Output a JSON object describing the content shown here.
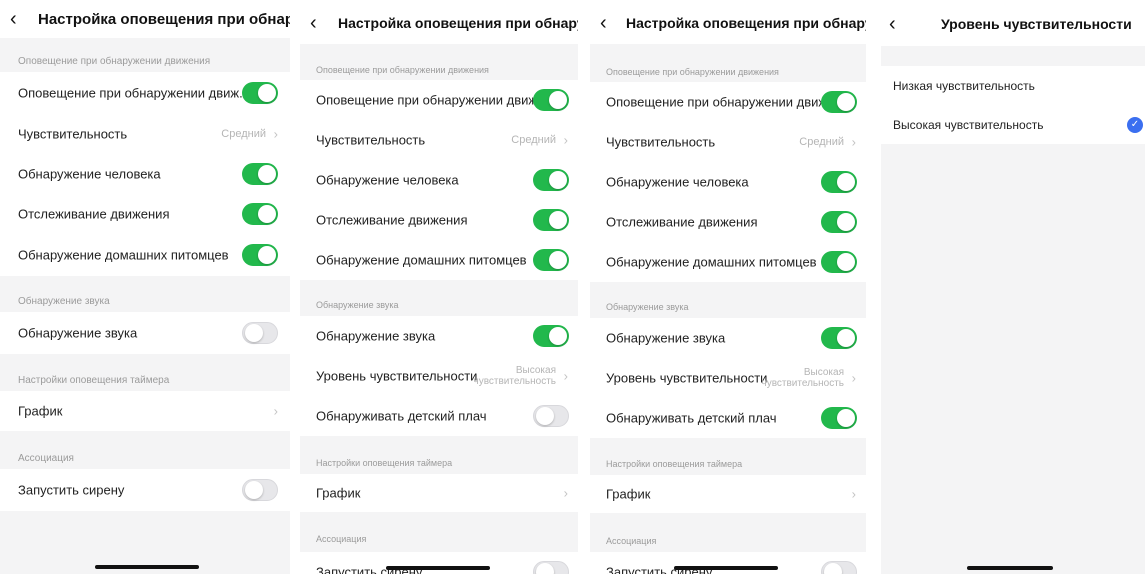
{
  "panel1": {
    "title": "Настройка оповещения при обнаруж...",
    "motion_section": "Оповещение при обнаружении движения",
    "motion_alert": "Оповещение при обнаружении движ...",
    "sensitivity": "Чувствительность",
    "sensitivity_value": "Средний",
    "human_detection": "Обнаружение человека",
    "motion_tracking": "Отслеживание движения",
    "pet_detection": "Обнаружение домашних питомцев",
    "sound_section": "Обнаружение звука",
    "sound_detection": "Обнаружение звука",
    "timer_section": "Настройки оповещения таймера",
    "schedule": "График",
    "assoc_section": "Ассоциация",
    "siren": "Запустить сирену"
  },
  "panel2": {
    "title": "Настройка оповещения при обнаруж...",
    "motion_section": "Оповещение при обнаружении движения",
    "motion_alert": "Оповещение при обнаружении движ...",
    "sensitivity": "Чувствительность",
    "sensitivity_value": "Средний",
    "human_detection": "Обнаружение человека",
    "motion_tracking": "Отслеживание движения",
    "pet_detection": "Обнаружение домашних питомцев",
    "sound_section": "Обнаружение звука",
    "sound_detection": "Обнаружение звука",
    "sound_level": "Уровень чувствительности",
    "sound_level_value_1": "Высокая",
    "sound_level_value_2": "чувствительность",
    "baby_cry": "Обнаруживать детский плач",
    "timer_section": "Настройки оповещения таймера",
    "schedule": "График",
    "assoc_section": "Ассоциация",
    "siren": "Запустить сирену"
  },
  "panel3": {
    "title": "Настройка оповещения при обнаруж...",
    "motion_section": "Оповещение при обнаружении движения",
    "motion_alert": "Оповещение при обнаружении движ...",
    "sensitivity": "Чувствительность",
    "sensitivity_value": "Средний",
    "human_detection": "Обнаружение человека",
    "motion_tracking": "Отслеживание движения",
    "pet_detection": "Обнаружение домашних питомцев",
    "sound_section": "Обнаружение звука",
    "sound_detection": "Обнаружение звука",
    "sound_level": "Уровень чувствительности",
    "sound_level_value_1": "Высокая",
    "sound_level_value_2": "чувствительность",
    "baby_cry": "Обнаруживать детский плач",
    "timer_section": "Настройки оповещения таймера",
    "schedule": "График",
    "assoc_section": "Ассоциация",
    "siren": "Запустить сирену"
  },
  "panel4": {
    "title": "Уровень чувствительности",
    "low": "Низкая чувствительность",
    "high": "Высокая чувствительность",
    "selected": "high"
  },
  "colors": {
    "toggle_on": "#22b84c",
    "toggle_off": "#e7e7ea",
    "check": "#3b6ff0"
  }
}
